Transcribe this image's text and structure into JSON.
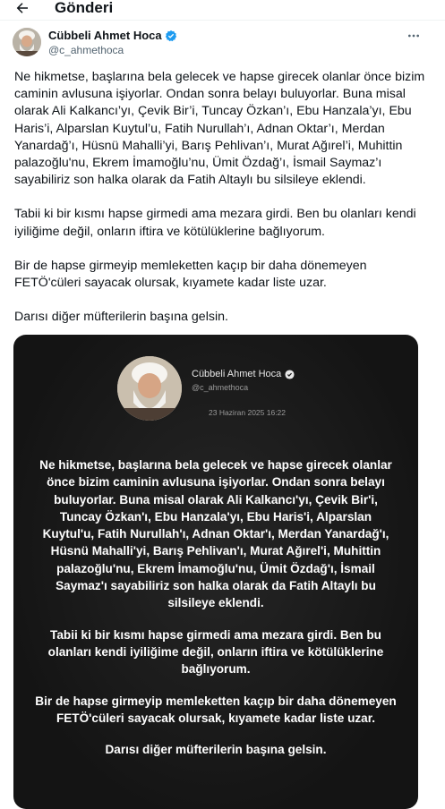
{
  "header": {
    "title": "Gönderi",
    "back_icon": "arrow-left-icon"
  },
  "author": {
    "name": "Cübbeli Ahmet Hoca",
    "handle": "@c_ahmethoca",
    "verified_icon": "verified-badge-icon",
    "badge_color": "#1d9bf0"
  },
  "more_icon": "more-horizontal-icon",
  "tweet": {
    "paragraphs": [
      "Ne hikmetse, başlarına bela gelecek ve hapse girecek olanlar önce bizim caminin avlusuna işiyorlar. Ondan sonra belayı buluyorlar. Buna misal olarak Ali Kalkancı’yı, Çevik Bir’i, Tuncay Özkan’ı, Ebu Hanzala’yı, Ebu Haris’i, Alparslan Kuytul’u, Fatih Nurullah’ı, Adnan Oktar’ı, Merdan Yanardağ’ı, Hüsnü Mahalli’yi, Barış Pehlivan’ı, Murat Ağırel’i, Muhittin palazoğlu'nu, Ekrem İmamoğlu’nu, Ümit Özdağ’ı, İsmail Saymaz’ı sayabiliriz son halka olarak da Fatih Altaylı bu silsileye eklendi.",
      "Tabii ki bir kısmı hapse girmedi ama mezara girdi. Ben bu olanları kendi iyiliğime değil, onların iftira ve kötülüklerine bağlıyorum.",
      "Bir de hapse girmeyip memleketten kaçıp bir daha dönemeyen FETÖ'cüleri sayacak olursak, kıyamete kadar liste uzar.",
      "Darısı diğer müfterilerin başına gelsin."
    ]
  },
  "card": {
    "name": "Cübbeli Ahmet Hoca",
    "handle": "@c_ahmethoca",
    "date": "23 Haziran 2025 16:22",
    "paragraphs": [
      "Ne hikmetse, başlarına bela gelecek ve hapse girecek olanlar önce bizim caminin avlusuna işiyorlar. Ondan sonra belayı buluyorlar. Buna misal olarak Ali Kalkancı'yı, Çevik Bir'i, Tuncay Özkan'ı, Ebu Hanzala'yı, Ebu Haris'i, Alparslan Kuytul'u, Fatih Nurullah'ı, Adnan Oktar'ı, Merdan Yanardağ'ı, Hüsnü Mahalli'yi, Barış Pehlivan'ı, Murat Ağırel'i, Muhittin palazoğlu'nu, Ekrem İmamoğlu'nu, Ümit Özdağ'ı, İsmail Saymaz'ı sayabiliriz son halka olarak da Fatih Altaylı bu silsileye eklendi.",
      "Tabii ki bir kısmı hapse girmedi ama mezara girdi. Ben bu olanları kendi iyiliğime değil, onların iftira ve kötülüklerine bağlıyorum.",
      "Bir de hapse girmeyip memleketten kaçıp bir daha dönemeyen FETÖ'cüleri sayacak olursak, kıyamete kadar liste uzar.",
      "Darısı diğer müfterilerin başına gelsin."
    ]
  }
}
